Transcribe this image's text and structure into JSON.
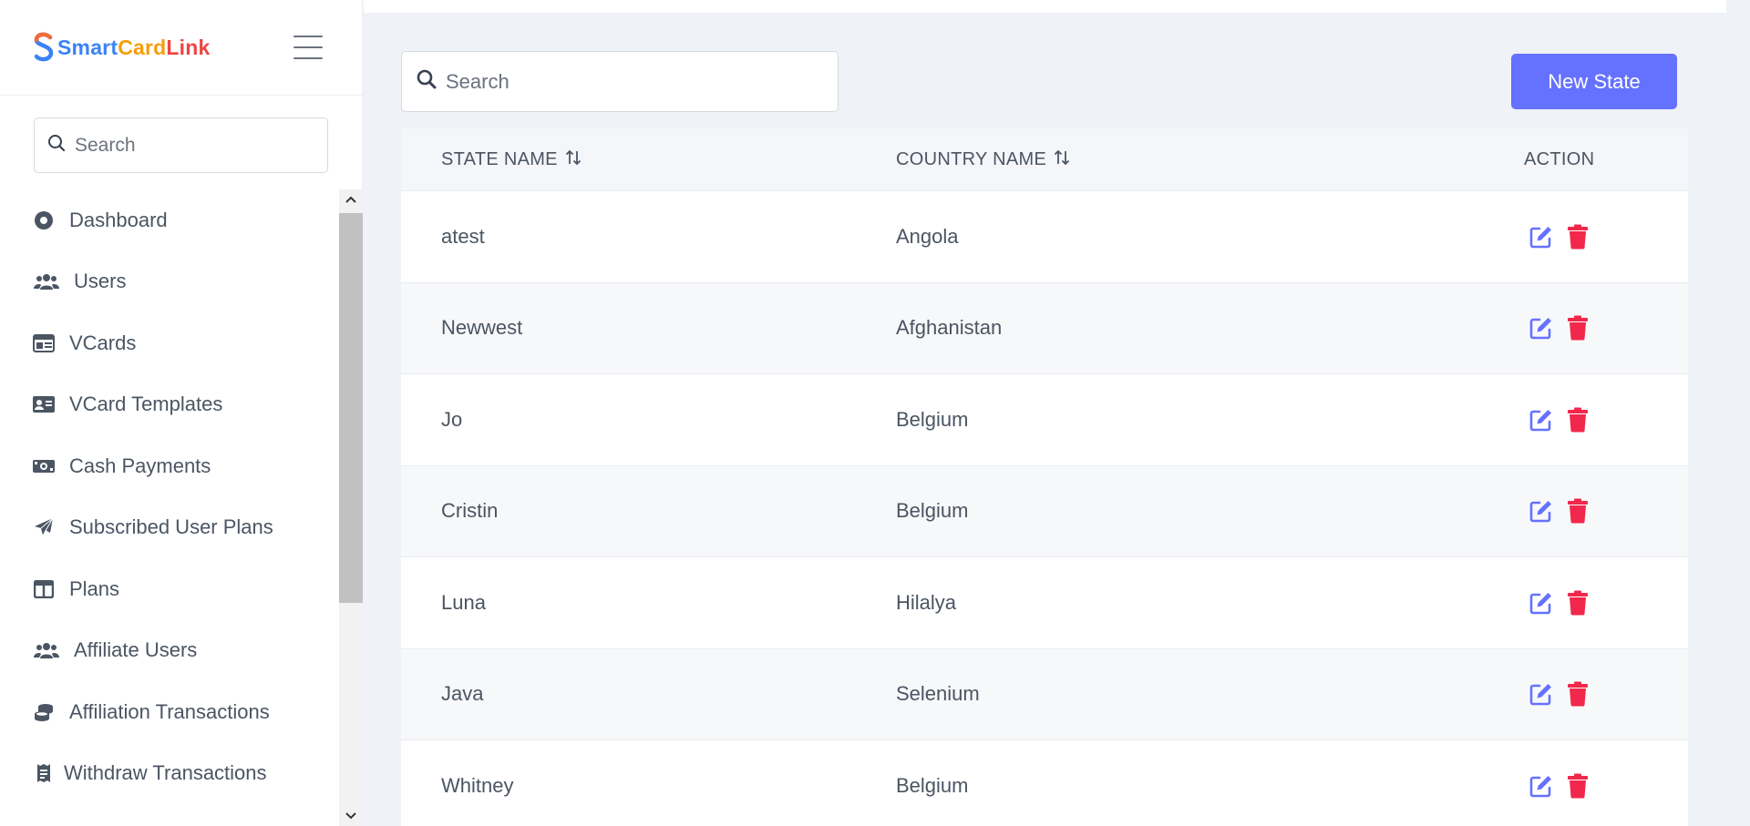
{
  "brand": {
    "logo_letter": "S",
    "name_part1": "Smart",
    "name_part2": "Card",
    "name_part3": "Link"
  },
  "sidebar": {
    "search_placeholder": "Search",
    "items": [
      {
        "label": "Dashboard",
        "icon": "dashboard-icon"
      },
      {
        "label": "Users",
        "icon": "users-icon"
      },
      {
        "label": "VCards",
        "icon": "vcard-icon"
      },
      {
        "label": "VCard Templates",
        "icon": "id-card-icon"
      },
      {
        "label": "Cash Payments",
        "icon": "money-bill-icon"
      },
      {
        "label": "Subscribed User Plans",
        "icon": "paper-plane-icon"
      },
      {
        "label": "Plans",
        "icon": "table-columns-icon"
      },
      {
        "label": "Affiliate Users",
        "icon": "users-icon"
      },
      {
        "label": "Affiliation Transactions",
        "icon": "coins-icon"
      },
      {
        "label": "Withdraw Transactions",
        "icon": "receipt-icon"
      }
    ]
  },
  "main": {
    "search_placeholder": "Search",
    "new_button_label": "New State",
    "columns": {
      "state": "STATE NAME",
      "country": "COUNTRY NAME",
      "action": "ACTION"
    },
    "rows": [
      {
        "state": "atest",
        "country": "Angola"
      },
      {
        "state": "Newwest",
        "country": "Afghanistan"
      },
      {
        "state": "Jo",
        "country": "Belgium"
      },
      {
        "state": "Cristin",
        "country": "Belgium"
      },
      {
        "state": "Luna",
        "country": "Hilalya"
      },
      {
        "state": "Java",
        "country": "Selenium"
      },
      {
        "state": "Whitney",
        "country": "Belgium"
      }
    ]
  },
  "colors": {
    "accent": "#6571ff",
    "edit": "#6571ff",
    "delete": "#f1284c"
  }
}
